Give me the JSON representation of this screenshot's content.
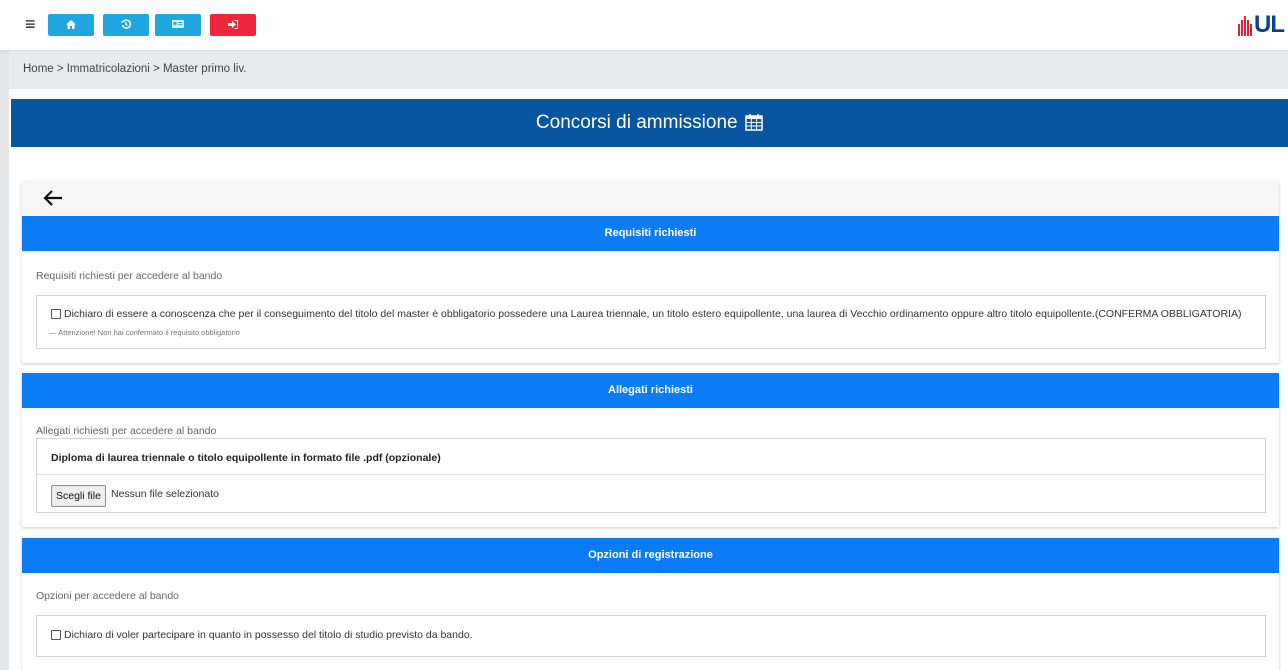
{
  "nav": {
    "menu_icon": "hamburger-icon",
    "buttons": [
      {
        "icon": "home-icon",
        "color": "#22a6e0"
      },
      {
        "icon": "history-icon",
        "color": "#22a6e0"
      },
      {
        "icon": "id-card-icon",
        "color": "#22a6e0"
      },
      {
        "icon": "logout-icon",
        "color": "#f0263c"
      }
    ],
    "logo_text": "UL"
  },
  "breadcrumb": "Home > Immatricolazioni > Master primo liv.",
  "page_title": "Concorsi di ammissione",
  "sections": {
    "requisiti": {
      "header": "Requisiti richiesti",
      "description": "Requisiti richiesti per accedere al bando",
      "checkbox_label": "Dichiaro di essere a conoscenza che per il conseguimento del titolo del master è obbligatorio possedere una Laurea triennale, un titolo estero equipollente, una laurea di Vecchio ordinamento oppure altro titolo equipollente.(CONFERMA OBBLIGATORIA)",
      "checked": false,
      "warning": "— Attenzione! Non hai confermato il requisito obbligatorio"
    },
    "allegati": {
      "header": "Allegati richiesti",
      "description": "Allegati richiesti per accedere al bando",
      "file_title": "Diploma di laurea triennale o titolo equipollente in formato file .pdf (opzionale)",
      "file_button": "Scegli file",
      "file_status": "Nessun file selezionato"
    },
    "opzioni": {
      "header": "Opzioni di registrazione",
      "description": "Opzioni per accedere al bando",
      "checkbox_label": "Dichiaro di voler partecipare in quanto in possesso del titolo di studio previsto da bando.",
      "checked": false
    }
  },
  "colors": {
    "header_blue": "#07569f",
    "section_blue": "#0b7cf5",
    "nav_blue": "#22a6e0",
    "nav_red": "#f0263c"
  }
}
